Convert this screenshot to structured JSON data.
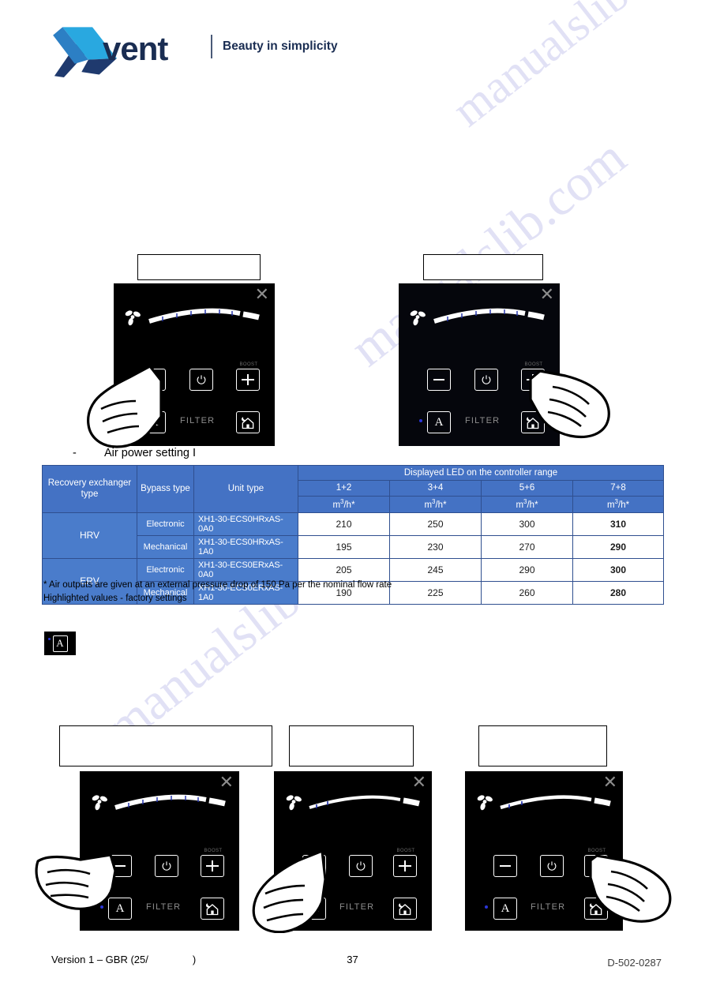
{
  "header": {
    "brand_x": "X",
    "brand_name": "vent",
    "tagline": "Beauty in simplicity",
    "logo_blue_light": "#29a8e0",
    "logo_blue_dark": "#1f3a6e"
  },
  "watermark": {
    "text": "manualslib.com"
  },
  "section": {
    "bullet": "-",
    "caption": "Air power setting I"
  },
  "top_panels": [
    {
      "id": "panel-decrease",
      "callout_text": "",
      "close_icon": "close-icon",
      "fan_icon": "fan-icon",
      "minus_label": "minus-icon",
      "power_label": "power-icon",
      "plus_label": "plus-icon",
      "boost_label": "BOOST",
      "auto_label": "A",
      "filter_label": "FILTER",
      "home_label": "home-night-icon",
      "active_button": "minus",
      "led_segments": 7,
      "led_active": 7
    },
    {
      "id": "panel-increase",
      "callout_text": "",
      "close_icon": "close-icon",
      "fan_icon": "fan-icon",
      "minus_label": "minus-icon",
      "power_label": "power-icon",
      "plus_label": "plus-icon",
      "boost_label": "BOOST",
      "auto_label": "A",
      "filter_label": "FILTER",
      "home_label": "home-night-icon",
      "active_button": "plus",
      "led_segments": 7,
      "led_active": 7
    }
  ],
  "auto_chip": {
    "label": "A",
    "name": "auto-mode-icon"
  },
  "bottom_panels": [
    {
      "id": "panel-auto",
      "callout_text": "",
      "close_icon": "close-icon",
      "fan_icon": "fan-icon",
      "boost_label": "BOOST",
      "auto_label": "A",
      "filter_label": "FILTER",
      "active_button": "auto",
      "led_segments": 7,
      "led_active": 7
    },
    {
      "id": "panel-minus-low",
      "callout_text": "",
      "close_icon": "close-icon",
      "fan_icon": "fan-icon",
      "boost_label": "BOOST",
      "auto_label": "A",
      "filter_label": "FILTER",
      "active_button": "minus",
      "led_segments": 1,
      "led_active": 1
    },
    {
      "id": "panel-plus-low",
      "callout_text": "",
      "close_icon": "close-icon",
      "fan_icon": "fan-icon",
      "boost_label": "BOOST",
      "auto_label": "A",
      "filter_label": "FILTER",
      "active_button": "plus",
      "led_segments": 2,
      "led_active": 2
    }
  ],
  "table": {
    "col_headers": {
      "recovery": "Recovery exchanger type",
      "bypass": "Bypass type",
      "unit": "Unit type",
      "led_group": "Displayed LED on the controller range"
    },
    "led_ranges": [
      "1+2",
      "3+4",
      "5+6",
      "7+8"
    ],
    "unit_row": [
      "m",
      "3",
      "/h*"
    ],
    "unit_display": "m3/h*",
    "rows": [
      {
        "recovery": "HRV",
        "recovery_rowspan": 2,
        "bypass": "Electronic",
        "unit": "XH1-30-ECS0HRxAS-0A0",
        "values": [
          "210",
          "250",
          "300",
          "310"
        ]
      },
      {
        "recovery": "",
        "bypass": "Mechanical",
        "unit": "XH1-30-ECS0HRxAS-1A0",
        "values": [
          "195",
          "230",
          "270",
          "290"
        ]
      },
      {
        "recovery": "ERV",
        "recovery_rowspan": 2,
        "bypass": "Electronic",
        "unit": "XH1-30-ECS0ERxAS-0A0",
        "values": [
          "205",
          "245",
          "290",
          "300"
        ]
      },
      {
        "recovery": "",
        "bypass": "Mechanical",
        "unit": "XH1-30-ECS0ERxAS-1A0",
        "values": [
          "190",
          "225",
          "260",
          "280"
        ]
      }
    ],
    "header_color": "#4472C4",
    "group_color": "#4A7CCB"
  },
  "notes": {
    "line1": "* Air outputs are given at an external pressure drop of 150 Pa per the nominal flow rate",
    "line2": "Highlighted values - factory settings"
  },
  "footer": {
    "left_prefix": "Version 1 – GBR (25/",
    "left_suffix": ")",
    "page_number": "37",
    "doc_code": "D-502-0287"
  }
}
